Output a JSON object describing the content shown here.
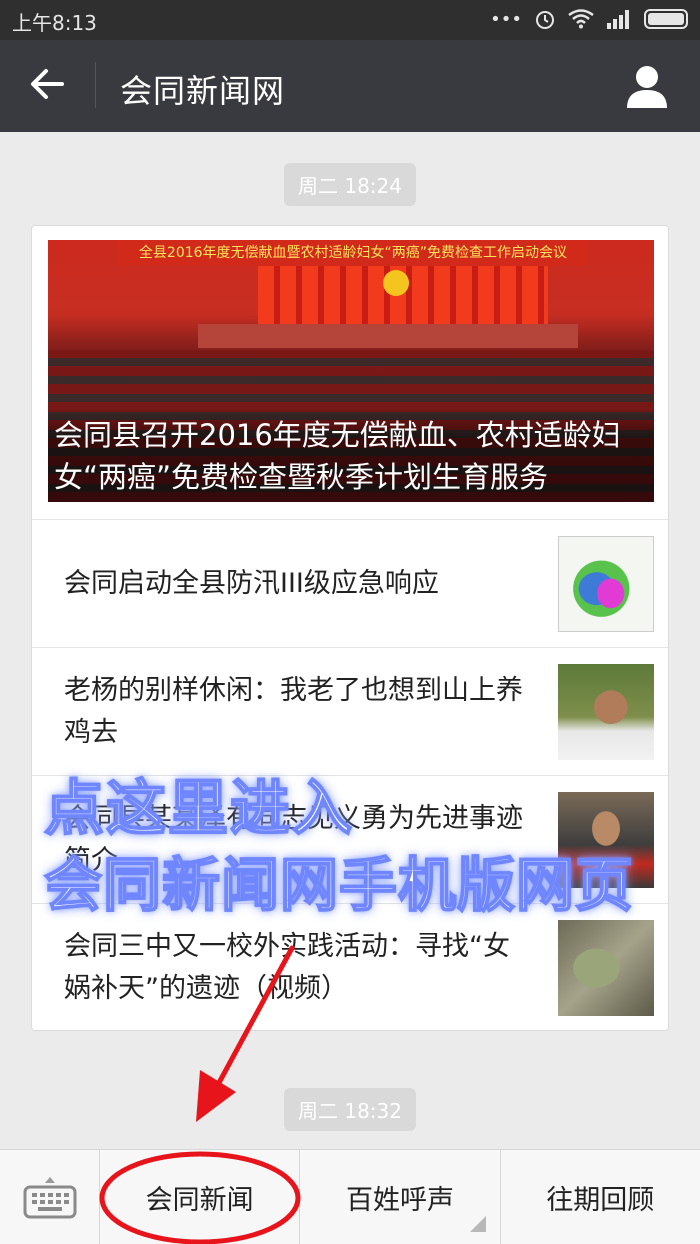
{
  "status": {
    "time": "上午8:13"
  },
  "header": {
    "title": "会同新闻网"
  },
  "chat": {
    "timestamp_1": "周二 18:24",
    "timestamp_2": "周二 18:32"
  },
  "articles": {
    "hero_caption": "会同县召开2016年度无偿献血、农村适龄妇女“两癌”免费检查暨秋季计划生育服务",
    "hero_banner": "全县2016年度无偿献血暨农村适龄妇女“两癌”免费检查工作启动会议",
    "items": [
      {
        "title": "会同启动全县防汛III级应急响应"
      },
      {
        "title": "老杨的别样休闲：我老了也想到山上养鸡去"
      },
      {
        "title": "会同县某某泽有同志见义勇为先进事迹简介"
      },
      {
        "title": "会同三中又一校外实践活动：寻找“女娲补天”的遗迹（视频）"
      }
    ]
  },
  "overlay": {
    "line1": "点这里进入",
    "line2": "会同新闻网手机版网页"
  },
  "menu": {
    "item1": "会同新闻",
    "item2": "百姓呼声",
    "item3": "往期回顾"
  },
  "colors": {
    "header_bg": "#393a3f",
    "annotation_red": "#e8141b",
    "overlay_glow": "#6f86ff"
  }
}
